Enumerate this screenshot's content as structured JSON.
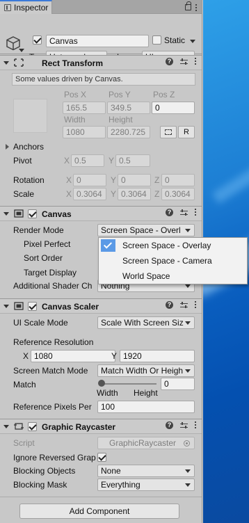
{
  "tab": {
    "label": "Inspector"
  },
  "header": {
    "object_name": "Canvas",
    "static_label": "Static",
    "tag_label": "Tag",
    "tag_value": "Untagged",
    "layer_label": "Layer",
    "layer_value": "UI"
  },
  "rect_transform": {
    "title": "Rect Transform",
    "info": "Some values driven by Canvas.",
    "pos_x_label": "Pos X",
    "pos_y_label": "Pos Y",
    "pos_z_label": "Pos Z",
    "pos_x": "165.5",
    "pos_y": "349.5",
    "pos_z": "0",
    "width_label": "Width",
    "height_label": "Height",
    "width": "1080",
    "height": "2280.725",
    "r_button": "R",
    "anchors_label": "Anchors",
    "pivot_label": "Pivot",
    "pivot_x": "0.5",
    "pivot_y": "0.5",
    "rotation_label": "Rotation",
    "rot_x": "0",
    "rot_y": "0",
    "rot_z": "0",
    "scale_label": "Scale",
    "scale_x": "0.3064",
    "scale_y": "0.3064",
    "scale_z": "0.3064",
    "x": "X",
    "y": "Y",
    "z": "Z"
  },
  "canvas": {
    "title": "Canvas",
    "render_mode_label": "Render Mode",
    "render_mode_value": "Screen Space - Overl",
    "pixel_perfect_label": "Pixel Perfect",
    "sort_order_label": "Sort Order",
    "target_display_label": "Target Display",
    "shader_label": "Additional Shader Ch",
    "shader_value": "Nothing"
  },
  "render_mode_options": [
    {
      "label": "Screen Space - Overlay",
      "selected": true
    },
    {
      "label": "Screen Space - Camera",
      "selected": false
    },
    {
      "label": "World Space",
      "selected": false
    }
  ],
  "canvas_scaler": {
    "title": "Canvas Scaler",
    "ui_scale_label": "UI Scale Mode",
    "ui_scale_value": "Scale With Screen Siz",
    "ref_res_label": "Reference Resolution",
    "ref_x": "1080",
    "ref_y": "1920",
    "match_mode_label": "Screen Match Mode",
    "match_mode_value": "Match Width Or Heigh",
    "match_label": "Match",
    "match_value": "0",
    "match_level": 0,
    "width_label": "Width",
    "height_label": "Height",
    "ref_pixels_label": "Reference Pixels Per",
    "ref_pixels_value": "100"
  },
  "raycaster": {
    "title": "Graphic Raycaster",
    "script_label": "Script",
    "script_value": "GraphicRaycaster",
    "ignore_label": "Ignore Reversed Grap",
    "blocking_objects_label": "Blocking Objects",
    "blocking_objects_value": "None",
    "blocking_mask_label": "Blocking Mask",
    "blocking_mask_value": "Everything"
  },
  "add_component": "Add Component"
}
